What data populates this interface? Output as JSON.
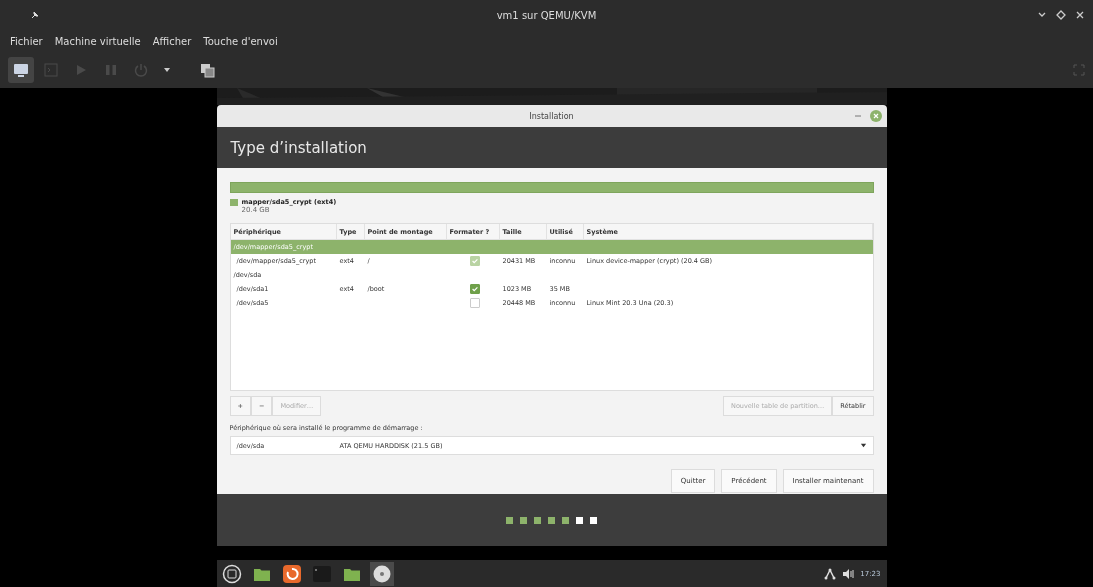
{
  "window": {
    "title": "vm1 sur QEMU/KVM"
  },
  "menu": [
    "Fichier",
    "Machine virtuelle",
    "Afficher",
    "Touche d'envoi"
  ],
  "toolbar": [
    {
      "kind": "display",
      "disabled": false,
      "selected": true
    },
    {
      "kind": "console",
      "disabled": true,
      "selected": false
    },
    {
      "kind": "play",
      "disabled": true,
      "selected": false
    },
    {
      "kind": "pause",
      "disabled": true,
      "selected": false
    },
    {
      "kind": "power",
      "disabled": true,
      "selected": false
    },
    {
      "kind": "caret",
      "disabled": false,
      "selected": false
    },
    {
      "kind": "snapshot",
      "disabled": false,
      "selected": false
    }
  ],
  "installer": {
    "title": "Installation",
    "heading": "Type d’installation",
    "legend": {
      "label": "mapper/sda5_crypt (ext4)",
      "size": "20.4 GB",
      "color": "#8db36b"
    },
    "columns": [
      "Périphérique",
      "Type",
      "Point de montage",
      "Formater ?",
      "Taille",
      "Utilisé",
      "Système"
    ],
    "groups": [
      {
        "device": "/dev/mapper/sda5_crypt",
        "selected": true,
        "children": [
          {
            "device": "/dev/mapper/sda5_crypt",
            "type": "ext4",
            "mount": "/",
            "format": {
              "checked": true,
              "disabled": true
            },
            "size": "20431 MB",
            "used": "inconnu",
            "system": "Linux device-mapper (crypt) (20.4 GB)"
          }
        ]
      },
      {
        "device": "/dev/sda",
        "selected": false,
        "children": [
          {
            "device": "/dev/sda1",
            "type": "ext4",
            "mount": "/boot",
            "format": {
              "checked": true,
              "disabled": false
            },
            "size": "1023 MB",
            "used": "35 MB"
          },
          {
            "device": "/dev/sda5",
            "format": {
              "checked": false,
              "disabled": false
            },
            "size": "20448 MB",
            "used": "inconnu",
            "system": "Linux Mint 20.3 Una (20.3)"
          }
        ]
      }
    ],
    "table_buttons": [
      {
        "label": "+",
        "disabled": false
      },
      {
        "label": "−",
        "disabled": false
      },
      {
        "label": "Modifier…",
        "disabled": true
      }
    ],
    "right_buttons": [
      {
        "label": "Nouvelle table de partition…",
        "disabled": true
      },
      {
        "label": "Rétablir",
        "disabled": false
      }
    ],
    "boot_label": "Périphérique où sera installé le programme de démarrage :",
    "boot_device": {
      "device": "/dev/sda",
      "description": "ATA QEMU HARDDISK (21.5 GB)"
    },
    "actions": [
      "Quitter",
      "Précédent",
      "Installer maintenant"
    ],
    "steps": [
      {
        "done": true
      },
      {
        "done": true
      },
      {
        "done": true
      },
      {
        "done": true
      },
      {
        "done": true
      },
      {
        "done": false
      },
      {
        "done": false
      }
    ]
  },
  "taskbar": {
    "apps": [
      {
        "kind": "menu",
        "active": false
      },
      {
        "kind": "folder",
        "active": false
      },
      {
        "kind": "update",
        "active": false
      },
      {
        "kind": "terminal",
        "active": false
      },
      {
        "kind": "folder",
        "active": false
      },
      {
        "kind": "disc",
        "active": true
      }
    ],
    "clock": "17:23"
  }
}
